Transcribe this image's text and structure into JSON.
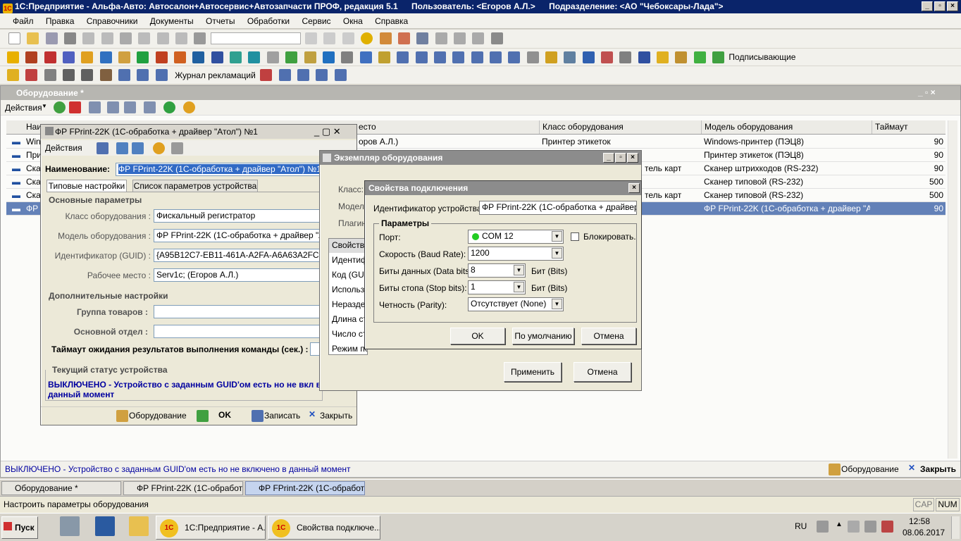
{
  "app": {
    "title": "1С:Предприятие - Альфа-Авто: Автосалон+Автосервис+Автозапчасти ПРОФ, редакция 5.1",
    "user": "Пользователь: <Егоров А.Л.>",
    "department": "Подразделение: <АО \"Чебоксары-Лада\">",
    "logo": "1С"
  },
  "menu": [
    "Файл",
    "Правка",
    "Справочники",
    "Документы",
    "Отчеты",
    "Обработки",
    "Сервис",
    "Окна",
    "Справка"
  ],
  "toolbar2": {
    "signers": "Подписывающие"
  },
  "toolbar3": {
    "journal": "Журнал рекламаций"
  },
  "list_window": {
    "title": "Оборудование *",
    "actions": "Действия",
    "columns": [
      "Наименование",
      "Рабочее место",
      "Класс оборудования",
      "Модель оборудования",
      "Таймаут"
    ],
    "rows": [
      {
        "name": "Win",
        "place": "оров А.Л.)",
        "klass": "Принтер этикеток",
        "model": "Windows-принтер (ПЭЦ8)",
        "timeout": "90"
      },
      {
        "name": "При",
        "place": "",
        "klass": "",
        "model": "Принтер этикеток (ПЭЦ8)",
        "timeout": "90"
      },
      {
        "name": "Ска",
        "place": "",
        "klass": "тель карт",
        "model": "Сканер штрихкодов (RS-232)",
        "timeout": "90"
      },
      {
        "name": "Ска",
        "place": "",
        "klass": "",
        "model": "Сканер типовой (RS-232)",
        "timeout": "500"
      },
      {
        "name": "Ска",
        "place": "",
        "klass": "тель карт",
        "model": "Сканер типовой (RS-232)",
        "timeout": "500"
      },
      {
        "name": "ФР",
        "place": "",
        "klass": "",
        "model": "ФР FPrint-22K (1С-обработка + драйвер \"Ат...",
        "timeout": "90"
      }
    ],
    "status": "ВЫКЛЮЧЕНО - Устройство с заданным GUID'ом есть но не включено в данный момент",
    "equipment_btn": "Оборудование",
    "close_btn": "Закрыть"
  },
  "item_window": {
    "title": "ФР FPrint-22K (1С-обработка + драйвер \"Атол\") №1",
    "actions": "Действия",
    "name_label": "Наименование:",
    "name_value": "ФР FPrint-22K (1С-обработка + драйвер \"Атол\") №1",
    "tab1": "Типовые настройки",
    "tab2": "Список параметров устройства",
    "section_main": "Основные параметры",
    "class_label": "Класс оборудования :",
    "class_value": "Фискальный регистратор",
    "model_label": "Модель оборудования :",
    "model_value": "ФР FPrint-22K (1С-обработка + драйвер \"Атол",
    "guid_label": "Идентификатор (GUID) :",
    "guid_value": "{A95B12C7-EB11-461A-A2FA-A6A63A2FCBC1}",
    "place_label": "Рабочее место :",
    "place_value": "Serv1c; (Егоров А.Л.)",
    "section_extra": "Дополнительные настройки",
    "group_label": "Группа товаров :",
    "dept_label": "Основной отдел :",
    "timeout_label": "Таймаут ожидания результатов выполнения команды (сек.) :",
    "status_section": "Текущий статус устройства",
    "status_text": "ВЫКЛЮЧЕНО - Устройство с заданным GUID'ом есть но не вкл в данный момент",
    "equipment_btn": "Оборудование",
    "ok_btn": "OK",
    "save_btn": "Записать",
    "close_btn": "Закрыть"
  },
  "instance_window": {
    "title": "Экземпляр оборудования",
    "class_label": "Класс:",
    "model_label": "Модель:",
    "plugin_label": "Плагин:",
    "list": [
      "Свойство",
      "Идентиф",
      "Код (GUI",
      "Использо",
      "Нераздел",
      "Длина ст",
      "Число стр",
      "Режим по"
    ],
    "apply_btn": "Применить",
    "cancel_btn": "Отмена"
  },
  "props_window": {
    "title": "Свойства подключения",
    "device_id_label": "Идентификатор устройства:",
    "device_id_value": "ФР FPrint-22K (1С-обработка + драйвер \"Ат",
    "params_group": "Параметры",
    "port_label": "Порт:",
    "port_value": "COM 12",
    "block_label": "Блокировать.",
    "speed_label": "Скорость (Baud Rate):",
    "speed_value": "1200",
    "databits_label": "Биты данных (Data bits):",
    "databits_value": "8",
    "stopbits_label": "Биты стопа (Stop bits):",
    "stopbits_value": "1",
    "bits_unit": "Бит (Bits)",
    "parity_label": "Четность (Parity):",
    "parity_value": "Отсутствует (None)",
    "ok_btn": "OK",
    "default_btn": "По умолчанию",
    "cancel_btn": "Отмена"
  },
  "window_tabs": [
    "Оборудование *",
    "ФР FPrint-22K (1С-обработк...",
    "ФР FPrint-22K (1С-обработк..."
  ],
  "statusbar": {
    "hint": "Настроить параметры оборудования",
    "cap": "CAP",
    "num": "NUM"
  },
  "taskbar": {
    "start": "Пуск",
    "task1": "1С:Предприятие - А...",
    "task2": "Свойства подключе...",
    "lang": "RU",
    "time": "12:58",
    "date": "08.06.2017"
  },
  "colors": {
    "title_bg": "#0a246a",
    "selection": "#6381b8",
    "status_green": "#22cc22",
    "status_blue": "#0000a0"
  }
}
